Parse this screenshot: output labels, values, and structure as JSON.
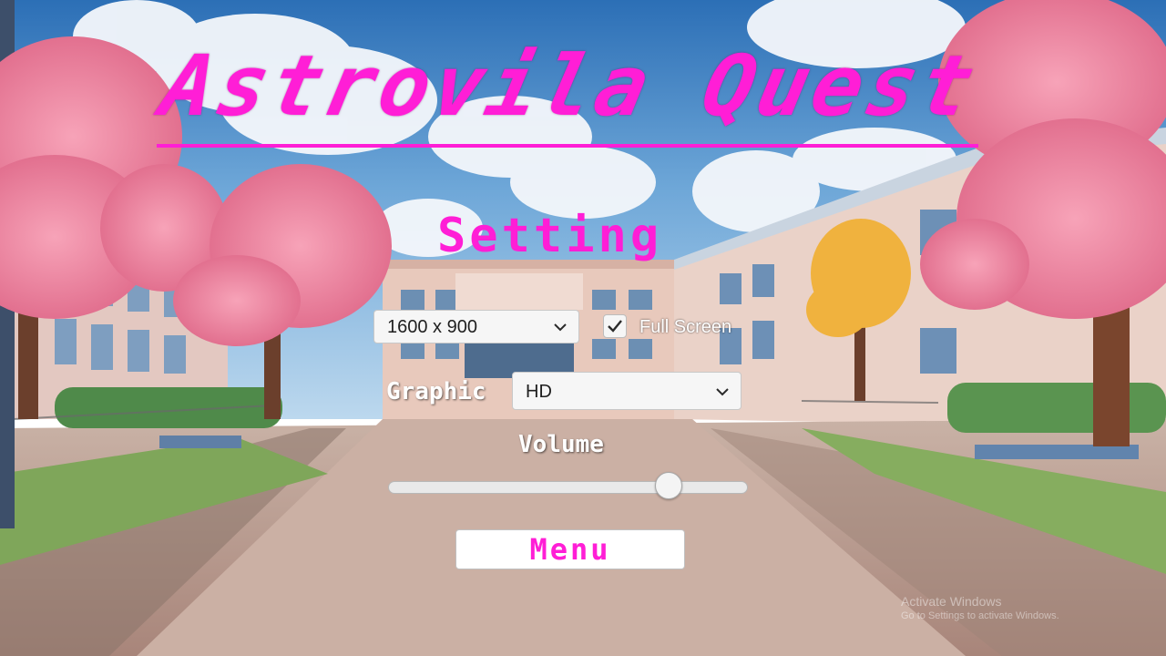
{
  "game": {
    "title": "Astrovila Quest",
    "screen_heading": "Setting"
  },
  "settings": {
    "resolution": {
      "selected": "1600 x 900"
    },
    "fullscreen": {
      "label": "Full Screen",
      "checked": true
    },
    "graphic": {
      "label": "Graphic",
      "selected": "HD"
    },
    "volume": {
      "label": "Volume",
      "value": 0.78
    }
  },
  "menu_button": {
    "label": "Menu"
  },
  "watermark": {
    "title": "Activate Windows",
    "subtitle": "Go to Settings to activate Windows."
  },
  "colors": {
    "accent": "#ff1ed6",
    "label_text": "#ffffff"
  },
  "icons": {
    "dropdown_arrow": "chevron-down-icon",
    "checkbox_mark": "checkmark-icon"
  }
}
